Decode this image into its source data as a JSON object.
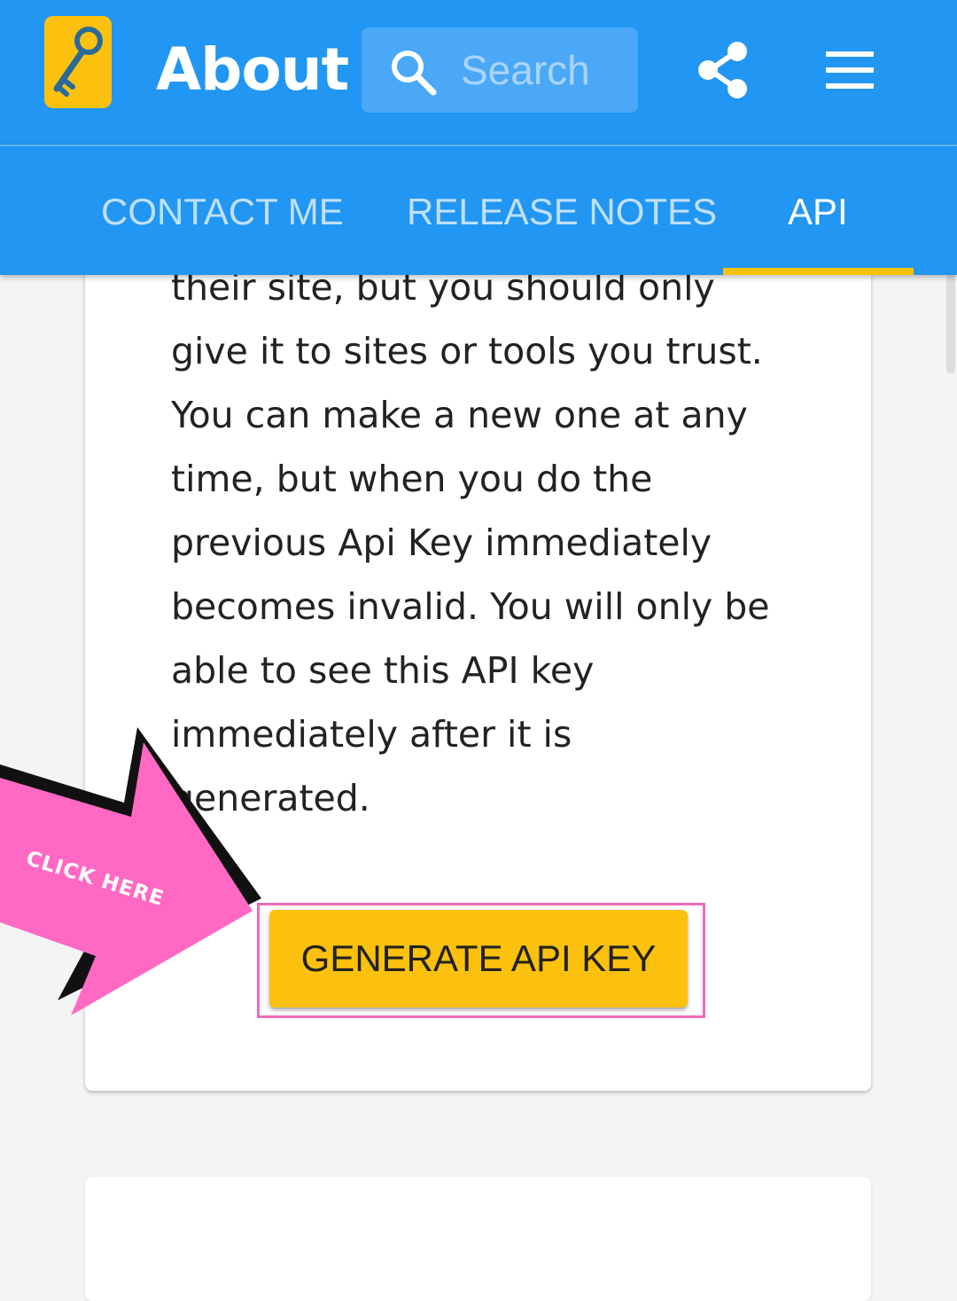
{
  "header": {
    "title": "About",
    "search": {
      "placeholder": "Search",
      "value": ""
    },
    "logo_icon": "key-icon",
    "share_icon": "share-icon",
    "menu_icon": "hamburger-menu-icon"
  },
  "tabs": [
    {
      "label": "CONTACT ME",
      "active": false
    },
    {
      "label": "RELEASE NOTES",
      "active": false
    },
    {
      "label": "API",
      "active": true
    }
  ],
  "api_card": {
    "lines": [
      "their site, but you should only",
      "give it to sites or tools you trust.",
      "You can make a new one at any",
      "time, but when you do the",
      "previous Api Key immediately",
      "becomes invalid. You will only be",
      "able to see this API key",
      "immediately after it is",
      "generated."
    ],
    "button_label": "GENERATE API KEY"
  },
  "annotation": {
    "label": "CLICK HERE"
  },
  "colors": {
    "primary": "#2196f3",
    "accent": "#fcc10e",
    "callout": "#ff69c4",
    "background": "#f4f4f4"
  }
}
